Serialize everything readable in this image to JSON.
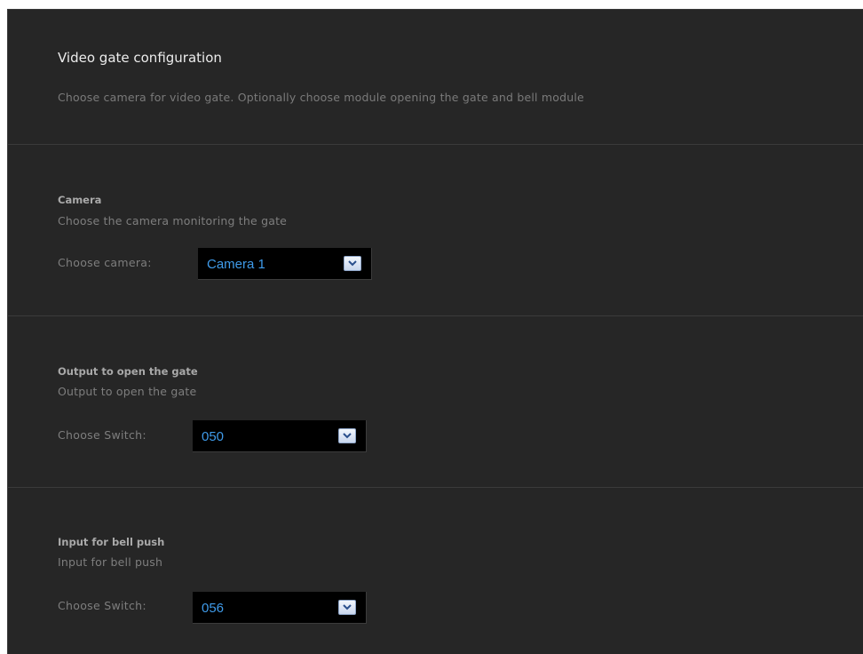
{
  "header": {
    "title": "Video gate configuration",
    "subtitle": "Choose camera for video gate. Optionally choose module opening the gate and bell module"
  },
  "camera": {
    "title": "Camera",
    "description": "Choose the camera monitoring the gate",
    "label": "Choose camera:",
    "value": "Camera 1"
  },
  "output": {
    "title": "Output to open the gate",
    "description": "Output to open the gate",
    "label": "Choose Switch:",
    "value": "050"
  },
  "input": {
    "title": "Input for bell push",
    "description": "Input for bell push",
    "label": "Choose Switch:",
    "value": "056"
  },
  "icons": {
    "dropdown": "chevron-down-icon"
  },
  "colors": {
    "background": "#262626",
    "select_background": "#000000",
    "select_text": "#3f9bea"
  }
}
